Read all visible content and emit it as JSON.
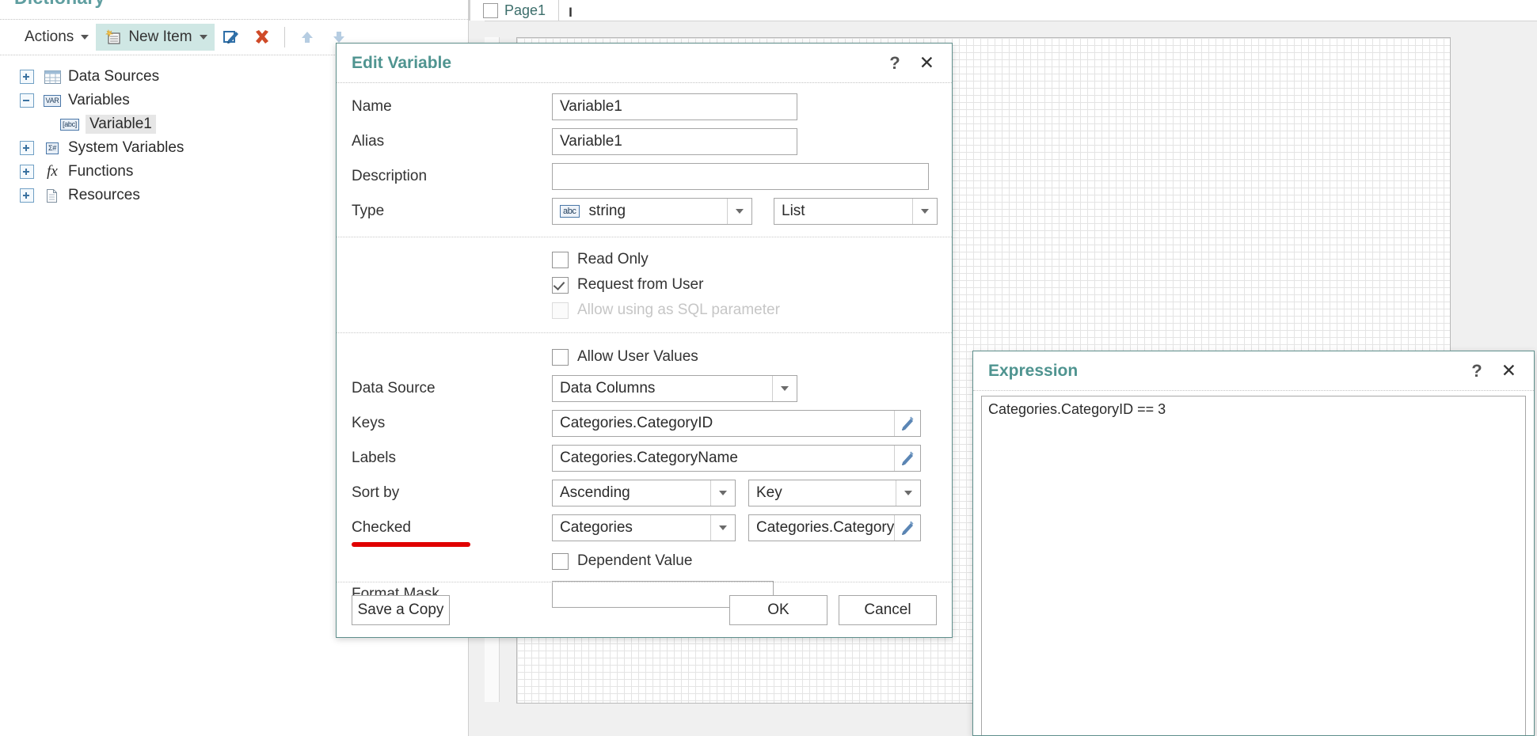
{
  "dictionary": {
    "title": "Dictionary",
    "toolbar": {
      "actions_label": "Actions",
      "new_item_label": "New Item",
      "edit_icon": "edit-pencil-icon",
      "delete_icon": "delete-cross-icon",
      "move_up_icon": "arrow-up-icon",
      "move_down_icon": "arrow-down-icon"
    },
    "tree": [
      {
        "label": "Data Sources",
        "expander": "plus",
        "icon": "table-icon",
        "badge": "",
        "selected": false,
        "child": false
      },
      {
        "label": "Variables",
        "expander": "minus",
        "icon": "var-badge-icon",
        "badge": "VAR",
        "selected": false,
        "child": false
      },
      {
        "label": "Variable1",
        "expander": "none",
        "icon": "abc-badge-icon",
        "badge": "[abc]",
        "selected": true,
        "child": true
      },
      {
        "label": "System Variables",
        "expander": "plus",
        "icon": "sysvar-badge-icon",
        "badge": "Σ#",
        "selected": false,
        "child": false
      },
      {
        "label": "Functions",
        "expander": "plus",
        "icon": "fx-icon",
        "badge": "fx",
        "selected": false,
        "child": false
      },
      {
        "label": "Resources",
        "expander": "plus",
        "icon": "document-icon",
        "badge": "",
        "selected": false,
        "child": false
      }
    ]
  },
  "canvas": {
    "page_tab_label": "Page1",
    "page_tab_bold": "I"
  },
  "edit_variable": {
    "title": "Edit Variable",
    "help_glyph": "?",
    "close_glyph": "✕",
    "fields": {
      "name_label": "Name",
      "name_value": "Variable1",
      "alias_label": "Alias",
      "alias_value": "Variable1",
      "description_label": "Description",
      "description_value": "",
      "type_label": "Type",
      "type_badge": "abc",
      "type_value": "string",
      "type_kind_value": "List",
      "data_source_label": "Data Source",
      "data_source_value": "Data Columns",
      "keys_label": "Keys",
      "keys_value": "Categories.CategoryID",
      "labels_label": "Labels",
      "labels_value": "Categories.CategoryName",
      "sort_by_label": "Sort by",
      "sort_direction_value": "Ascending",
      "sort_field_value": "Key",
      "checked_label": "Checked",
      "checked_source_value": "Categories",
      "checked_expression_value": "Categories.CategoryI",
      "format_mask_label": "Format Mask",
      "format_mask_value": ""
    },
    "checkboxes": [
      {
        "label": "Read Only",
        "checked": false,
        "disabled": false
      },
      {
        "label": "Request from User",
        "checked": true,
        "disabled": false
      },
      {
        "label": "Allow using as SQL parameter",
        "checked": false,
        "disabled": true
      },
      {
        "label": "Allow User Values",
        "checked": false,
        "disabled": false
      },
      {
        "label": "Dependent Value",
        "checked": false,
        "disabled": false
      }
    ],
    "buttons": {
      "save_copy_label": "Save a Copy",
      "ok_label": "OK",
      "cancel_label": "Cancel"
    },
    "annotation": {
      "underline_color": "#e00000",
      "underlined_label": "Checked"
    }
  },
  "expression": {
    "title": "Expression",
    "help_glyph": "?",
    "close_glyph": "✕",
    "body_text": "Categories.CategoryID == 3"
  },
  "colors": {
    "accent_teal": "#4f9490",
    "title_teal": "#5f9ea0",
    "highlight_bg": "#cfe7e4",
    "annotation_red": "#e00000"
  }
}
